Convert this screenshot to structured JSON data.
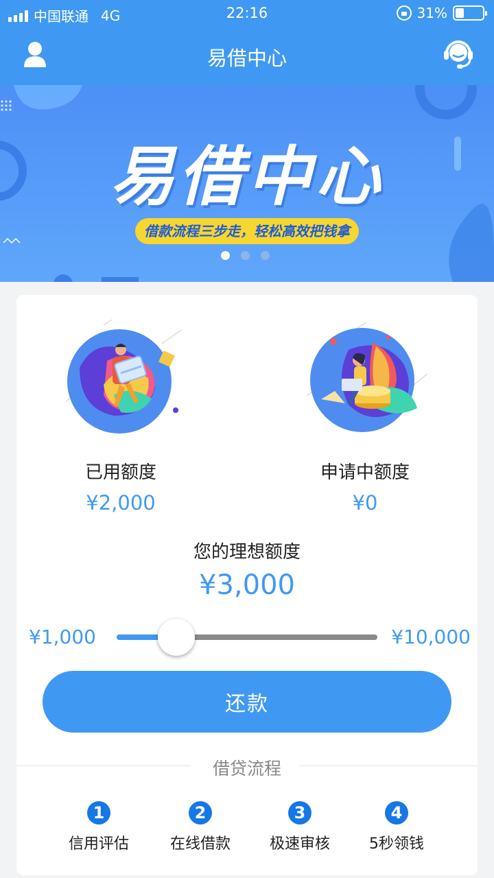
{
  "status_bar": {
    "carrier": "中国联通",
    "network": "4G",
    "time": "22:16",
    "battery_percent": "31%",
    "battery_level": 0.31
  },
  "nav": {
    "title": "易借中心",
    "left_icon": "user-icon",
    "right_icon": "customer-service-icon"
  },
  "banner": {
    "title": "易借中心",
    "subtitle": "借款流程三步走，轻松高效把钱拿",
    "slide_count": 3,
    "active_slide": 1
  },
  "stats": {
    "used_label": "已用额度",
    "used_value": "¥2,000",
    "pending_label": "申请中额度",
    "pending_value": "¥0"
  },
  "ideal": {
    "label": "您的理想额度",
    "value": "¥3,000",
    "min_label": "¥1,000",
    "max_label": "¥10,000",
    "slider_fraction": 0.23
  },
  "repay_button": "还款",
  "process": {
    "title": "借贷流程",
    "steps": [
      {
        "num": "1",
        "label": "信用评估"
      },
      {
        "num": "2",
        "label": "在线借款"
      },
      {
        "num": "3",
        "label": "极速审核"
      },
      {
        "num": "4",
        "label": "5秒领钱"
      }
    ]
  },
  "colors": {
    "primary": "#3f99f3",
    "banner_pill": "#f7d630",
    "step_badge": "#1677e6"
  }
}
